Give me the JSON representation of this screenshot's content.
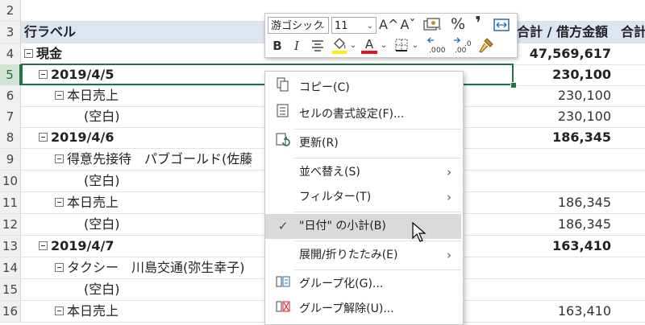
{
  "rows": [
    {
      "num": "2",
      "label": "",
      "value": "",
      "extra": ""
    },
    {
      "num": "3",
      "label": "行ラベル",
      "value": "合計 / 借方金額",
      "extra": "合計"
    },
    {
      "num": "4",
      "label": "現金",
      "value": "47,569,617",
      "extra": ""
    },
    {
      "num": "5",
      "label": "2019/4/5",
      "value": "230,100",
      "extra": ""
    },
    {
      "num": "6",
      "label": "本日売上",
      "value": "230,100",
      "extra": ""
    },
    {
      "num": "7",
      "label": "(空白)",
      "value": "230,100",
      "extra": ""
    },
    {
      "num": "8",
      "label": "2019/4/6",
      "value": "186,345",
      "extra": ""
    },
    {
      "num": "9",
      "label": "得意先接待　パブゴールド(佐藤",
      "value": "",
      "extra": ""
    },
    {
      "num": "10",
      "label": "(空白)",
      "value": "",
      "extra": ""
    },
    {
      "num": "11",
      "label": "本日売上",
      "value": "186,345",
      "extra": ""
    },
    {
      "num": "12",
      "label": "(空白)",
      "value": "186,345",
      "extra": ""
    },
    {
      "num": "13",
      "label": "2019/4/7",
      "value": "163,410",
      "extra": ""
    },
    {
      "num": "14",
      "label": "タクシー　川島交通(弥生幸子)",
      "value": "",
      "extra": ""
    },
    {
      "num": "15",
      "label": "(空白)",
      "value": "",
      "extra": ""
    },
    {
      "num": "16",
      "label": "本日売上",
      "value": "163,410",
      "extra": ""
    }
  ],
  "mini_toolbar": {
    "font_name": "游ゴシック",
    "font_size": "11",
    "grow_font": "A^",
    "shrink_font": "Aˇ",
    "percent": "%",
    "comma": "❜",
    "bold": "B",
    "italic": "I",
    "font_color_letter": "A"
  },
  "context_menu": {
    "copy": "コピー(C)",
    "format_cells": "セルの書式設定(F)...",
    "refresh": "更新(R)",
    "sort": "並べ替え(S)",
    "filter": "フィルター(T)",
    "subtotal": "\"日付\" の小計(B)",
    "expand_collapse": "展開/折りたたみ(E)",
    "group": "グループ化(G)...",
    "ungroup": "グループ解除(U)..."
  },
  "colors": {
    "accent": "#217346",
    "header_fill": "#dde5f3",
    "menu_highlight": "#dadada"
  }
}
